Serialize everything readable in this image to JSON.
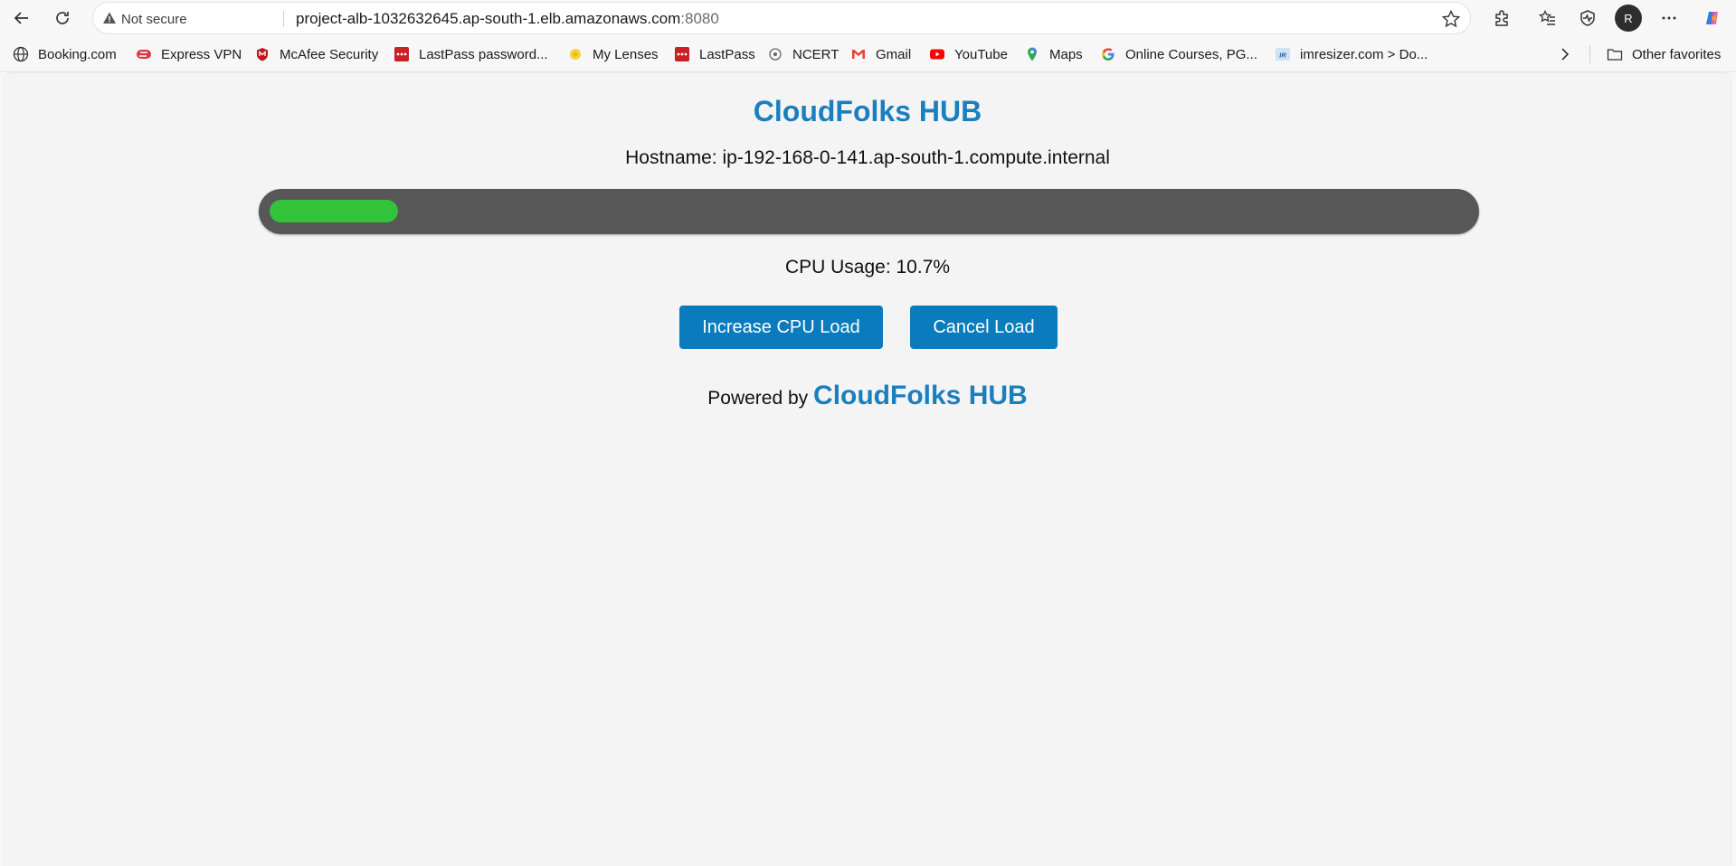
{
  "browser": {
    "security_label": "Not secure",
    "url_main": "project-alb-1032632645.ap-south-1.elb.amazonaws.com",
    "url_port": ":8080",
    "profile_initial": "R"
  },
  "bookmarks": {
    "items": [
      {
        "label": "Booking.com",
        "icon": "globe-icon"
      },
      {
        "label": "Express VPN",
        "icon": "expressvpn-icon"
      },
      {
        "label": "McAfee Security",
        "icon": "mcafee-icon"
      },
      {
        "label": "LastPass password...",
        "icon": "lastpass-icon"
      },
      {
        "label": "My Lenses",
        "icon": "lenses-icon"
      },
      {
        "label": "LastPass",
        "icon": "lastpass-icon"
      },
      {
        "label": "NCERT",
        "icon": "ncert-icon"
      },
      {
        "label": "Gmail",
        "icon": "gmail-icon"
      },
      {
        "label": "YouTube",
        "icon": "youtube-icon"
      },
      {
        "label": "Maps",
        "icon": "maps-icon"
      },
      {
        "label": "Online Courses, PG...",
        "icon": "google-icon"
      },
      {
        "label": "imresizer.com > Do...",
        "icon": "imresizer-icon"
      }
    ],
    "other_favorites": "Other favorites"
  },
  "app": {
    "title": "CloudFolks HUB",
    "hostname": "Hostname: ip-192-168-0-141.ap-south-1.compute.internal",
    "cpu_label": "CPU Usage: 10.7%",
    "cpu_percent": 10.7,
    "increase_label": "Increase CPU Load",
    "cancel_label": "Cancel Load",
    "powered_prefix": "Powered by",
    "powered_brand": "CloudFolks HUB",
    "colors": {
      "accent": "#1a7fbf",
      "button": "#0a7bbd",
      "progress_fill": "#33c33a",
      "progress_track": "#575757"
    }
  }
}
